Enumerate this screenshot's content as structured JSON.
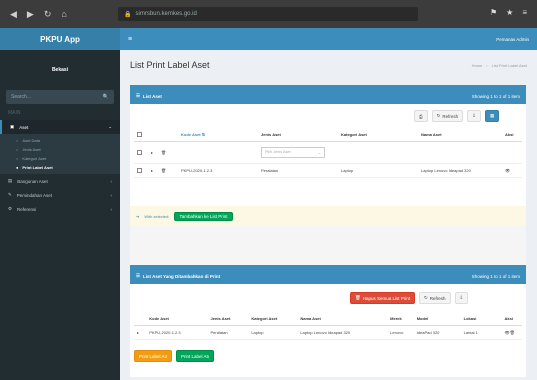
{
  "browser": {
    "url": "simrsbun.kemkes.go.id"
  },
  "app": {
    "title": "PKPU App",
    "user_name": "Bekasi",
    "header_user": "Pemanas Admin",
    "search_placeholder": "Search..."
  },
  "sidebar": {
    "header": "MAIN",
    "items": [
      {
        "label": "Aset",
        "icon": "folder-icon",
        "active": true
      },
      {
        "label": "Bangunan Aset",
        "icon": "building-icon"
      },
      {
        "label": "Pemindahan Aset",
        "icon": "wrench-icon"
      },
      {
        "label": "Referensi",
        "icon": "cog-icon"
      }
    ],
    "subitems": [
      {
        "label": "Aset Data"
      },
      {
        "label": "Jenis Aset"
      },
      {
        "label": "Kategori Aset"
      },
      {
        "label": "Print Label Aset",
        "current": true
      }
    ]
  },
  "page": {
    "title": "List Print Label Aset",
    "breadcrumb": [
      "Home",
      "List Print Label Aset"
    ]
  },
  "box1": {
    "title": "List Aset",
    "count": "Showing 1 to 1 of 1 item",
    "toolbar": {
      "refresh": "↻",
      "refresh_label": "Refresh",
      "export": "⇩",
      "grid": "▦"
    },
    "columns": [
      "",
      "",
      "",
      "Kode Aset",
      "Jenis Aset",
      "Kategori Aset",
      "Nama Aset",
      "Aksi"
    ],
    "filter_placeholder": "Pilih Jenis Aset",
    "rows": [
      {
        "kode": "PKPU-2020-1.2.3",
        "jenis": "Peralatan",
        "kategori": "Laptop",
        "nama": "Laptop Lenovo Ideapad 320"
      }
    ],
    "with_selected": "With selected:",
    "add_button": "Tambahkan ke List Print"
  },
  "box2": {
    "title": "List Aset Yang Ditambahkan di Print",
    "count": "Showing 1 to 1 of 1 item",
    "toolbar": {
      "delete_all": "Hapus Semua List Print",
      "refresh_label": "Refresh",
      "export": "⇩"
    },
    "columns": [
      "",
      "Kode Aset",
      "Jenis Aset",
      "Kategori Aset",
      "Nama Aset",
      "Merek",
      "Model",
      "Lokasi",
      "Aksi"
    ],
    "rows": [
      {
        "kode": "PKPU-2020-1.2.3",
        "jenis": "Peralatan",
        "kategori": "Laptop",
        "nama": "Laptop Lenovo Ideapad 320",
        "merek": "Lenovo",
        "model": "IdeaPad 320",
        "lokasi": "Lantai 1"
      }
    ],
    "print_label_a": "Print Label A4",
    "print_label_b": "Print Label A5"
  },
  "colors": {
    "primary": "#3c8dbc",
    "sidebar": "#222d32",
    "danger": "#dd4b39",
    "success": "#00a65a",
    "warning": "#f39c12"
  }
}
